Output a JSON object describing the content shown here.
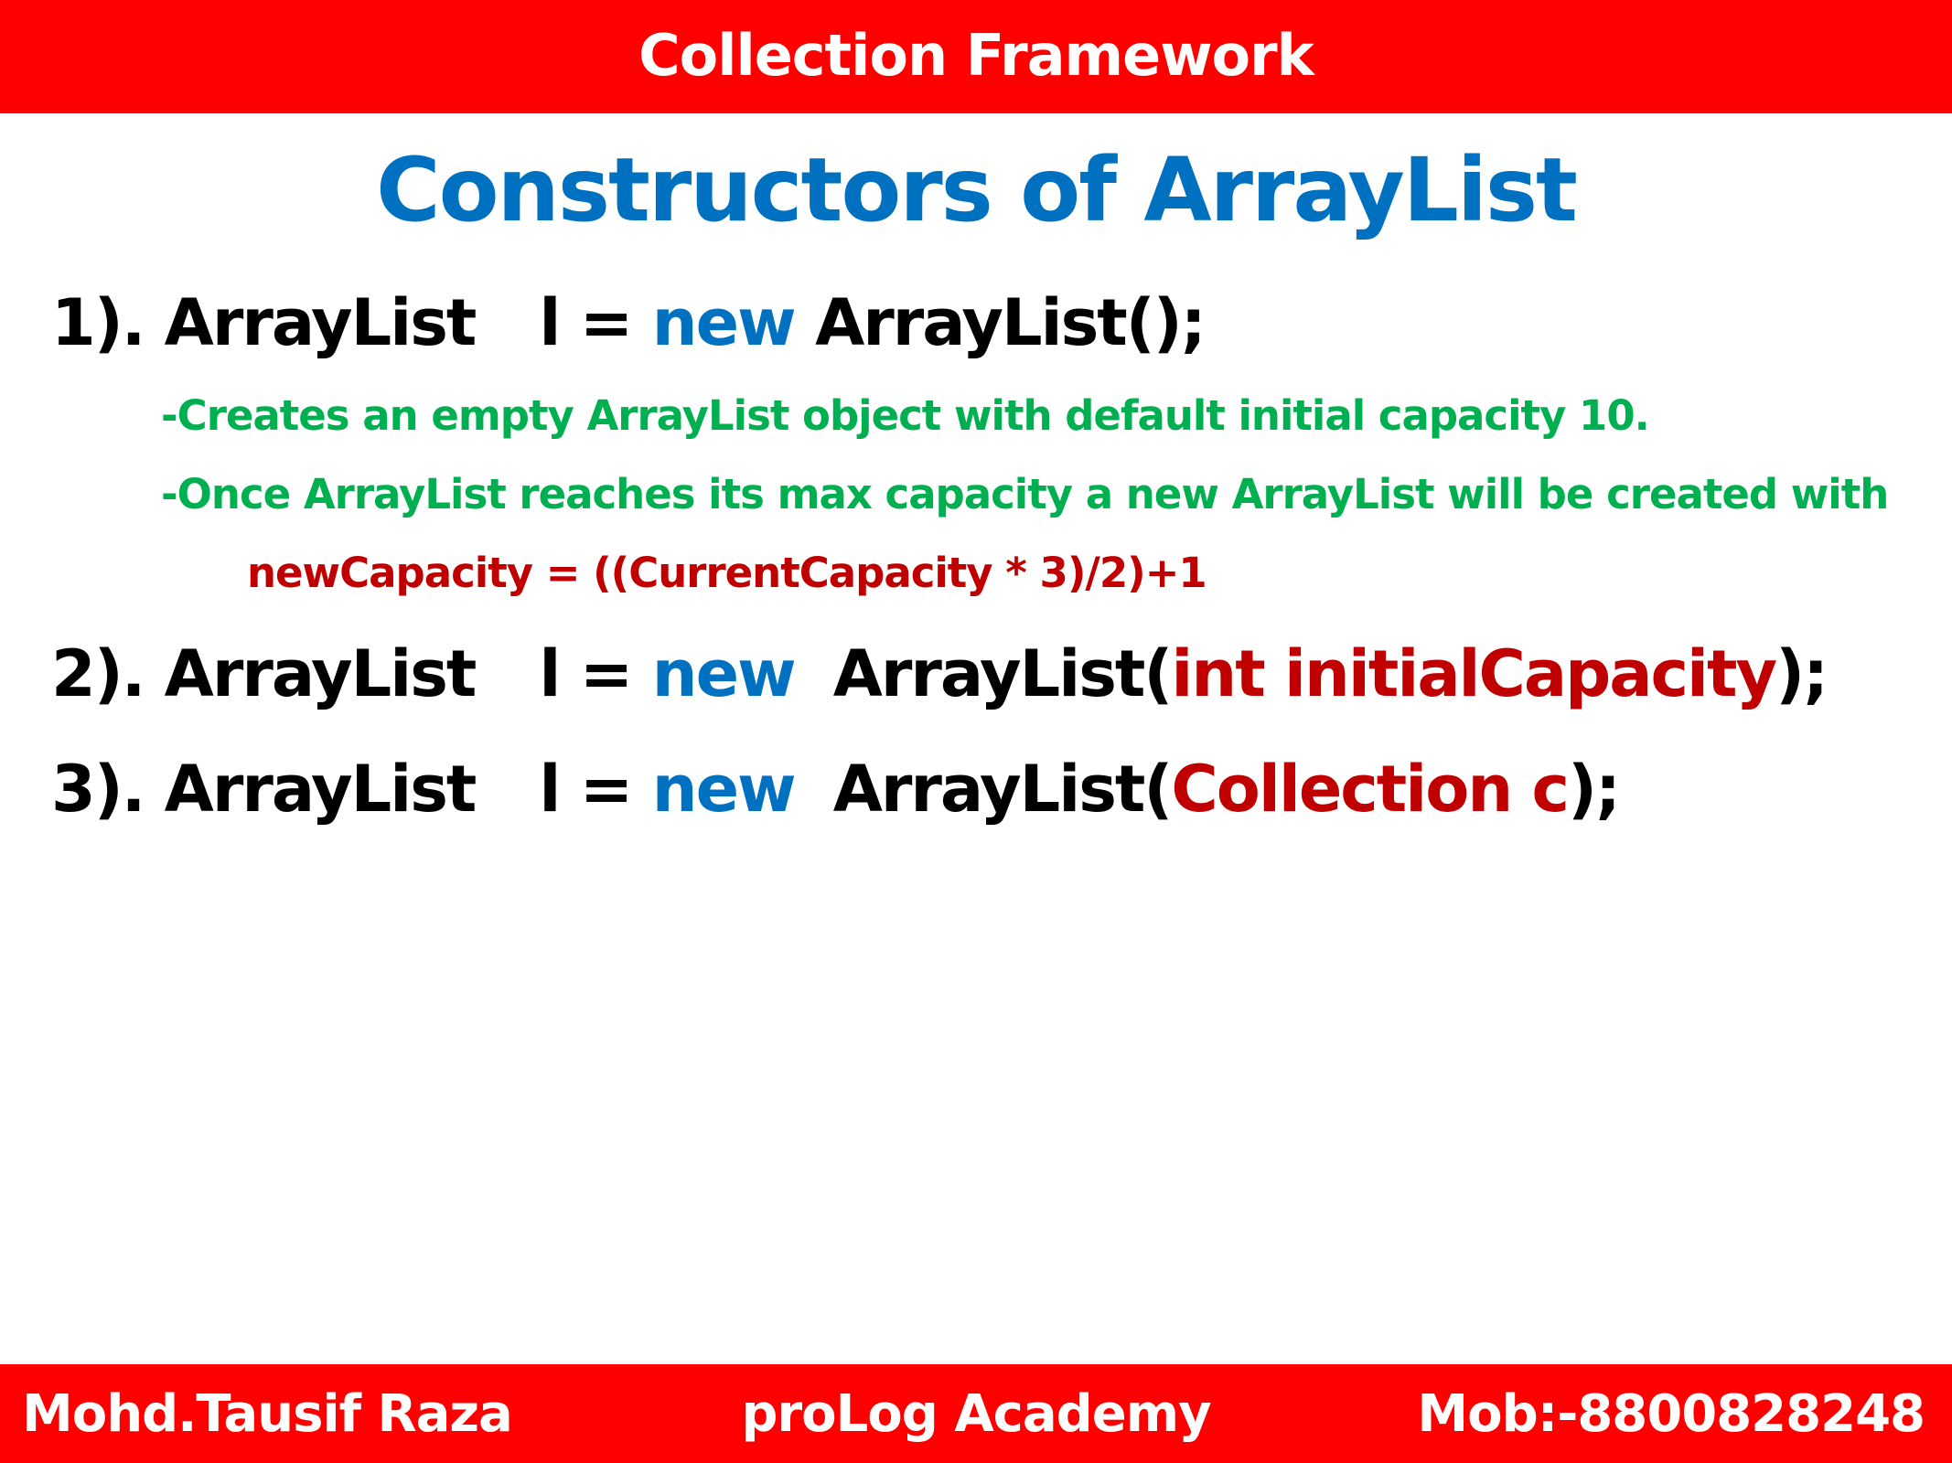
{
  "header": {
    "title": "Collection Framework"
  },
  "slide_title": "Constructors of ArrayList",
  "constructors": [
    {
      "number": "1).",
      "type": "ArrayList",
      "var": "l",
      "equals": "=",
      "keyword": "new",
      "class_call": "ArrayList(",
      "param": "",
      "close": ");"
    },
    {
      "number": "2).",
      "type": "ArrayList",
      "var": "l",
      "equals": "=",
      "keyword": "new",
      "class_call": "ArrayList(",
      "param": "int initialCapacity",
      "close": ");"
    },
    {
      "number": "3).",
      "type": "ArrayList",
      "var": "l",
      "equals": "=",
      "keyword": "new",
      "class_call": "ArrayList(",
      "param": "Collection c",
      "close": ");"
    }
  ],
  "notes": [
    "-Creates an empty ArrayList object with default initial capacity 10.",
    "-Once ArrayList reaches its max capacity a new ArrayList will be created with"
  ],
  "formula": "newCapacity = ((CurrentCapacity * 3)/2)+1",
  "footer": {
    "author": "Mohd.Tausif Raza",
    "academy": "proLog Academy",
    "mobile": "Mob:-8800828248"
  },
  "colors": {
    "banner": "#ff0000",
    "title": "#0070c0",
    "keyword": "#0070c0",
    "param": "#c00000",
    "note": "#00b050",
    "formula": "#c00000"
  }
}
